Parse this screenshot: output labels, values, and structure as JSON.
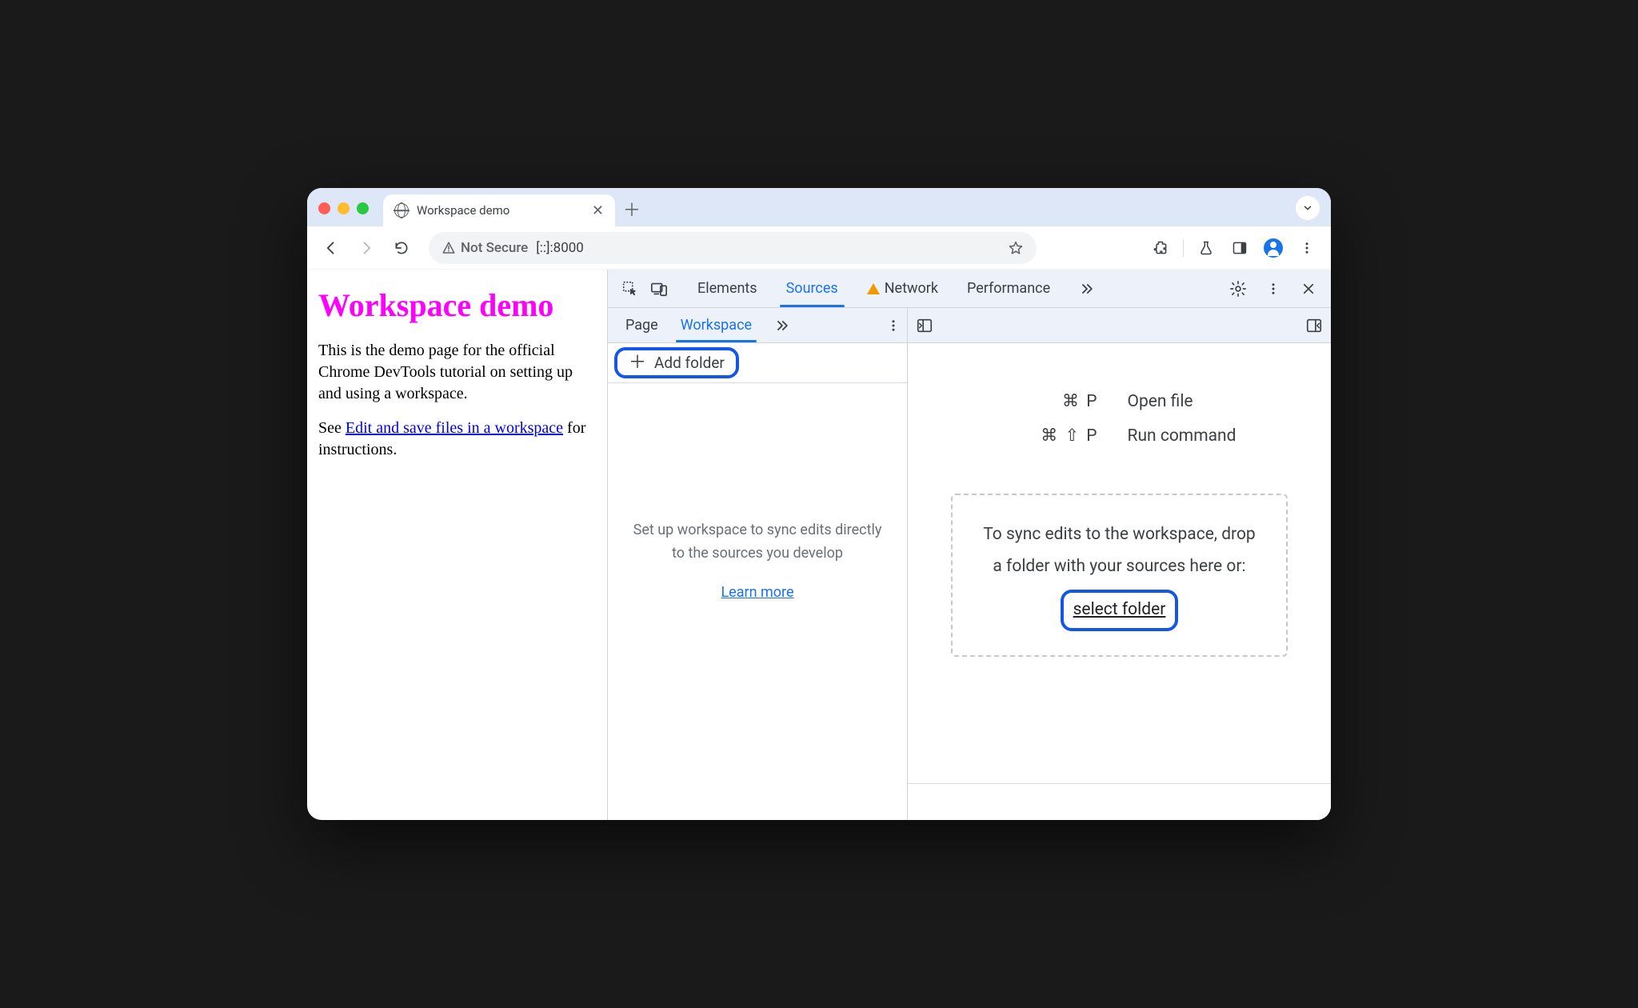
{
  "browser": {
    "tab_title": "Workspace demo",
    "not_secure": "Not Secure",
    "url": "[::]:8000"
  },
  "page": {
    "heading": "Workspace demo",
    "p1": "This is the demo page for the official Chrome DevTools tutorial on setting up and using a workspace.",
    "p2_pre": "See ",
    "p2_link": "Edit and save files in a workspace",
    "p2_post": " for instructions."
  },
  "devtools": {
    "tabs": {
      "elements": "Elements",
      "sources": "Sources",
      "network": "Network",
      "performance": "Performance"
    },
    "subtabs": {
      "page": "Page",
      "workspace": "Workspace"
    },
    "add_folder": "Add folder",
    "workspace_hint": "Set up workspace to sync edits directly to the sources you develop",
    "learn_more": "Learn more",
    "shortcuts": {
      "open_file_keys": "⌘ P",
      "open_file_label": "Open file",
      "run_cmd_keys": "⌘ ⇧ P",
      "run_cmd_label": "Run command"
    },
    "drop_hint_l1": "To sync edits to the workspace, drop",
    "drop_hint_l2": "a folder with your sources here or:",
    "select_folder": "select folder"
  }
}
